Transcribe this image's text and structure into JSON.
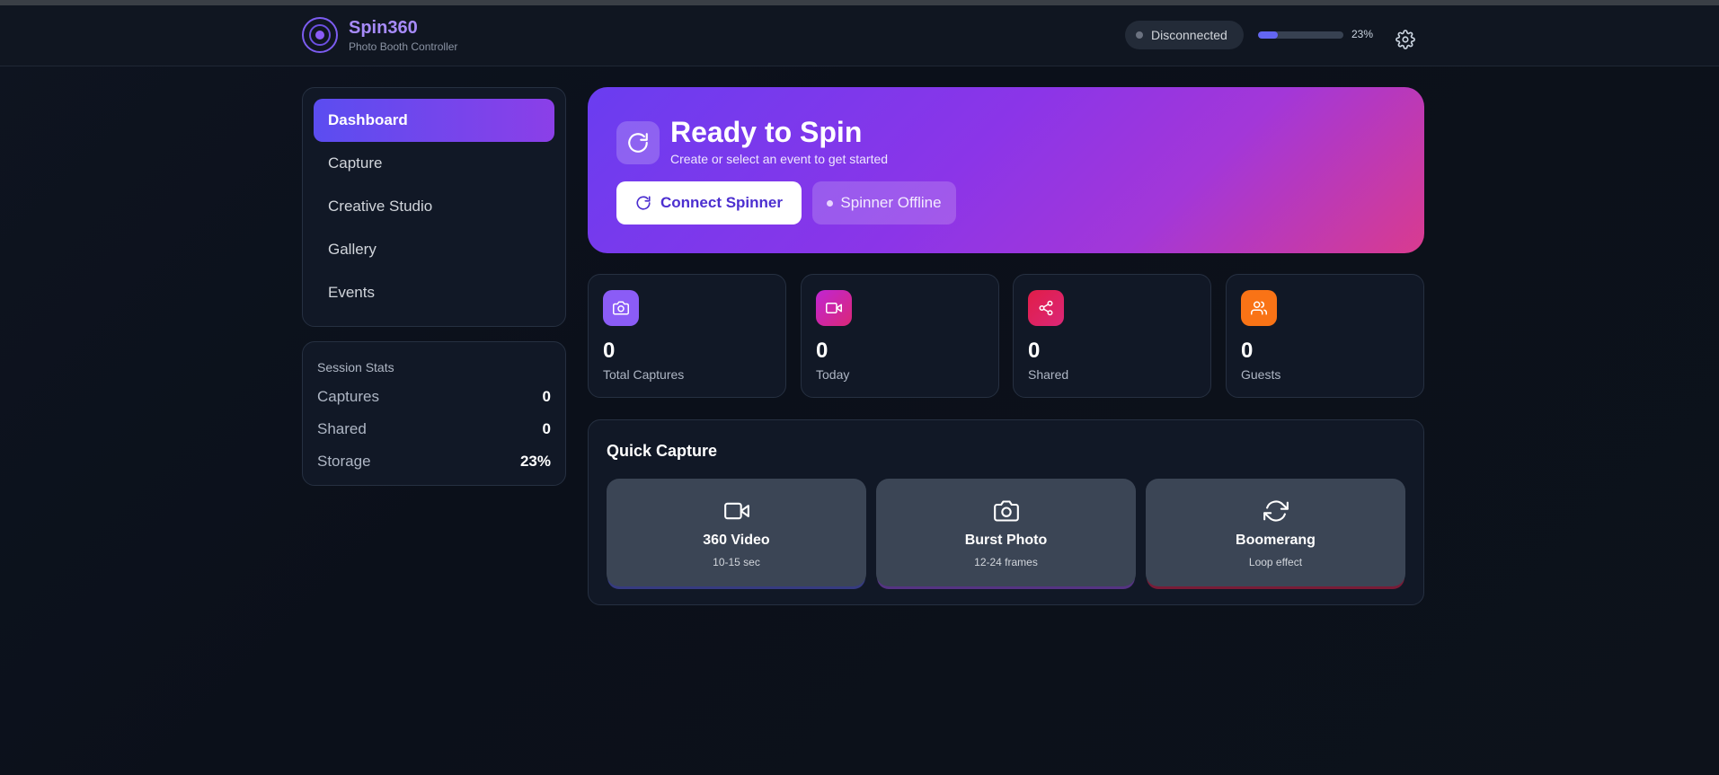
{
  "header": {
    "app_name": "Spin360",
    "app_subtitle": "Photo Booth Controller",
    "connection_status": "Disconnected",
    "storage_percent": 23,
    "storage_label": "23%"
  },
  "sidebar": {
    "items": [
      {
        "label": "Dashboard",
        "active": true
      },
      {
        "label": "Capture"
      },
      {
        "label": "Creative Studio"
      },
      {
        "label": "Gallery"
      },
      {
        "label": "Events"
      }
    ]
  },
  "session_stats": {
    "title": "Session Stats",
    "rows": [
      {
        "label": "Captures",
        "value": "0"
      },
      {
        "label": "Shared",
        "value": "0"
      },
      {
        "label": "Storage",
        "value": "23%"
      }
    ]
  },
  "hero": {
    "title": "Ready to Spin",
    "subtitle": "Create or select an event to get started",
    "connect_label": "Connect Spinner",
    "offline_label": "Spinner Offline"
  },
  "metrics": [
    {
      "value": "0",
      "label": "Total Captures",
      "icon": "camera-icon",
      "color": "#8b5cf6"
    },
    {
      "value": "0",
      "label": "Today",
      "icon": "video-icon",
      "color": "#c026d3"
    },
    {
      "value": "0",
      "label": "Shared",
      "icon": "share-icon",
      "color": "#e11d48"
    },
    {
      "value": "0",
      "label": "Guests",
      "icon": "users-icon",
      "color": "#f97316"
    }
  ],
  "quick_capture": {
    "title": "Quick Capture",
    "modes": [
      {
        "name": "360 Video",
        "desc": "10-15 sec",
        "icon": "video-icon"
      },
      {
        "name": "Burst Photo",
        "desc": "12-24 frames",
        "icon": "camera-icon"
      },
      {
        "name": "Boomerang",
        "desc": "Loop effect",
        "icon": "refresh-icon"
      }
    ]
  }
}
